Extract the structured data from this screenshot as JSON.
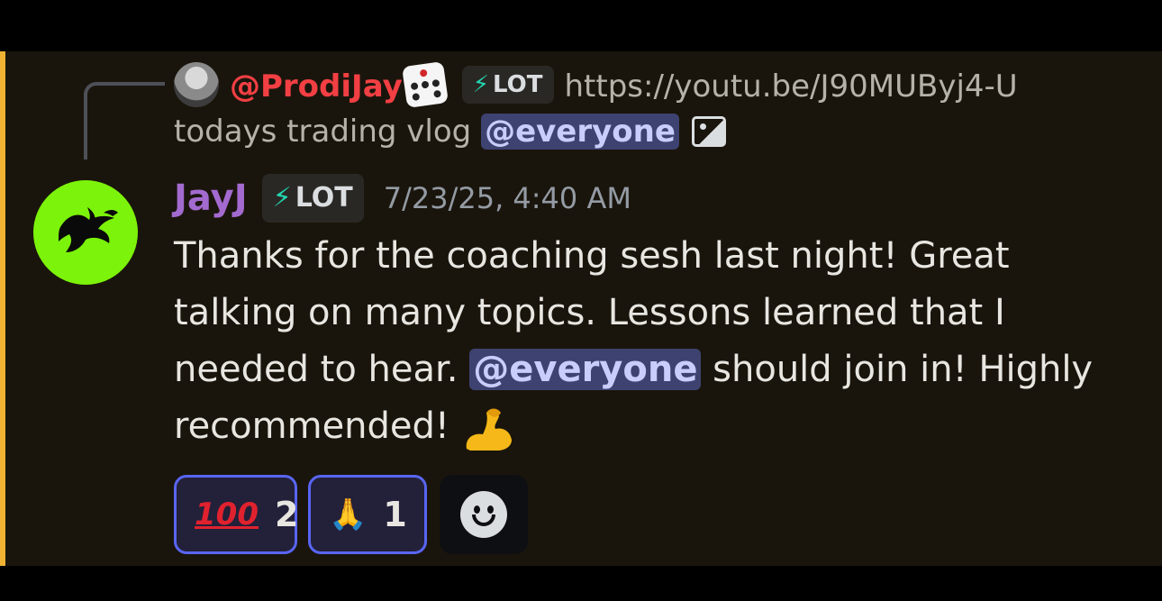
{
  "reply": {
    "author": "@ProdiJay",
    "role_tag": "LOT",
    "link": "https://youtu.be/J90MUByj4-U",
    "text": "todays trading vlog",
    "mention": "@everyone"
  },
  "message": {
    "author": "JayJ",
    "role_tag": "LOT",
    "timestamp": "7/23/25, 4:40 AM",
    "content_part1": "Thanks for the coaching sesh last night! Great talking on many topics. Lessons learned that I needed to hear. ",
    "mention": "@everyone",
    "content_part2": " should join in! Highly recommended! "
  },
  "reactions": [
    {
      "emoji": "💯",
      "label": "100",
      "count": "2"
    },
    {
      "emoji": "🙏",
      "count": "1"
    }
  ],
  "colors": {
    "mention_highlight_bar": "#f0b232",
    "author_color": "#a36acf",
    "reply_author_color": "#f23f43",
    "mention_bg": "#3d4270",
    "reaction_border": "#5865f2",
    "avatar_bg": "#7cf30a"
  },
  "icons": {
    "role_icon": "lightning-bolt-icon",
    "attachment_icon": "image-icon",
    "add_reaction_icon": "smiley-icon"
  }
}
